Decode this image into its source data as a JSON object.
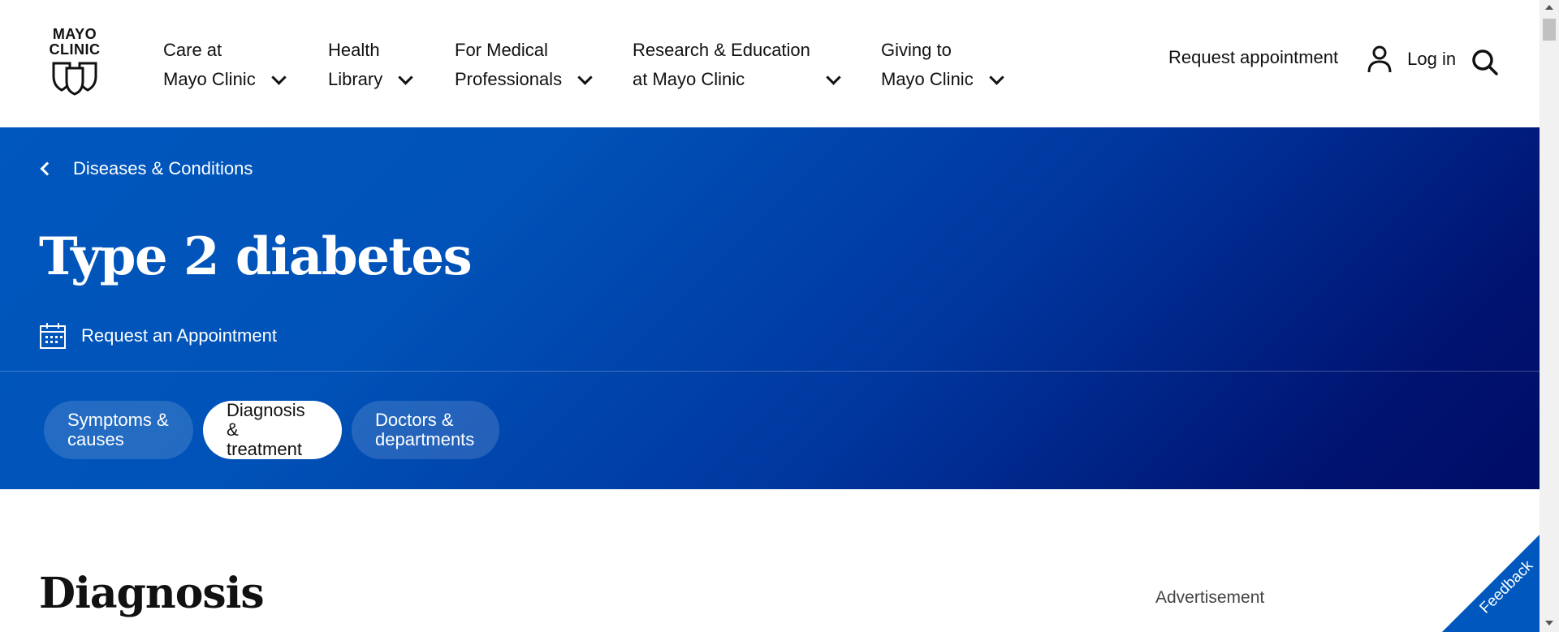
{
  "logo": {
    "line1": "MAYO",
    "line2": "CLINIC"
  },
  "nav": [
    {
      "line1": "Care at",
      "line2": "Mayo Clinic"
    },
    {
      "line1": "Health",
      "line2": "Library"
    },
    {
      "line1": "For Medical",
      "line2": "Professionals"
    },
    {
      "line1": "Research & Education",
      "line2": "at Mayo Clinic"
    },
    {
      "line1": "Giving to",
      "line2": "Mayo Clinic"
    }
  ],
  "header_actions": {
    "request_appointment": "Request appointment",
    "login": "Log in"
  },
  "hero": {
    "breadcrumb": "Diseases & Conditions",
    "title": "Type 2 diabetes",
    "request_link": "Request an Appointment",
    "tabs": [
      {
        "line1": "Symptoms &",
        "line2": "causes",
        "active": false
      },
      {
        "line1": "Diagnosis &",
        "line2": "treatment",
        "active": true
      },
      {
        "line1": "Doctors &",
        "line2": "departments",
        "active": false
      }
    ]
  },
  "content": {
    "heading": "Diagnosis",
    "ad_label": "Advertisement"
  },
  "feedback": "Feedback",
  "colors": {
    "hero_start": "#0057bd",
    "hero_end": "#000d66",
    "accent": "#0057bd"
  }
}
